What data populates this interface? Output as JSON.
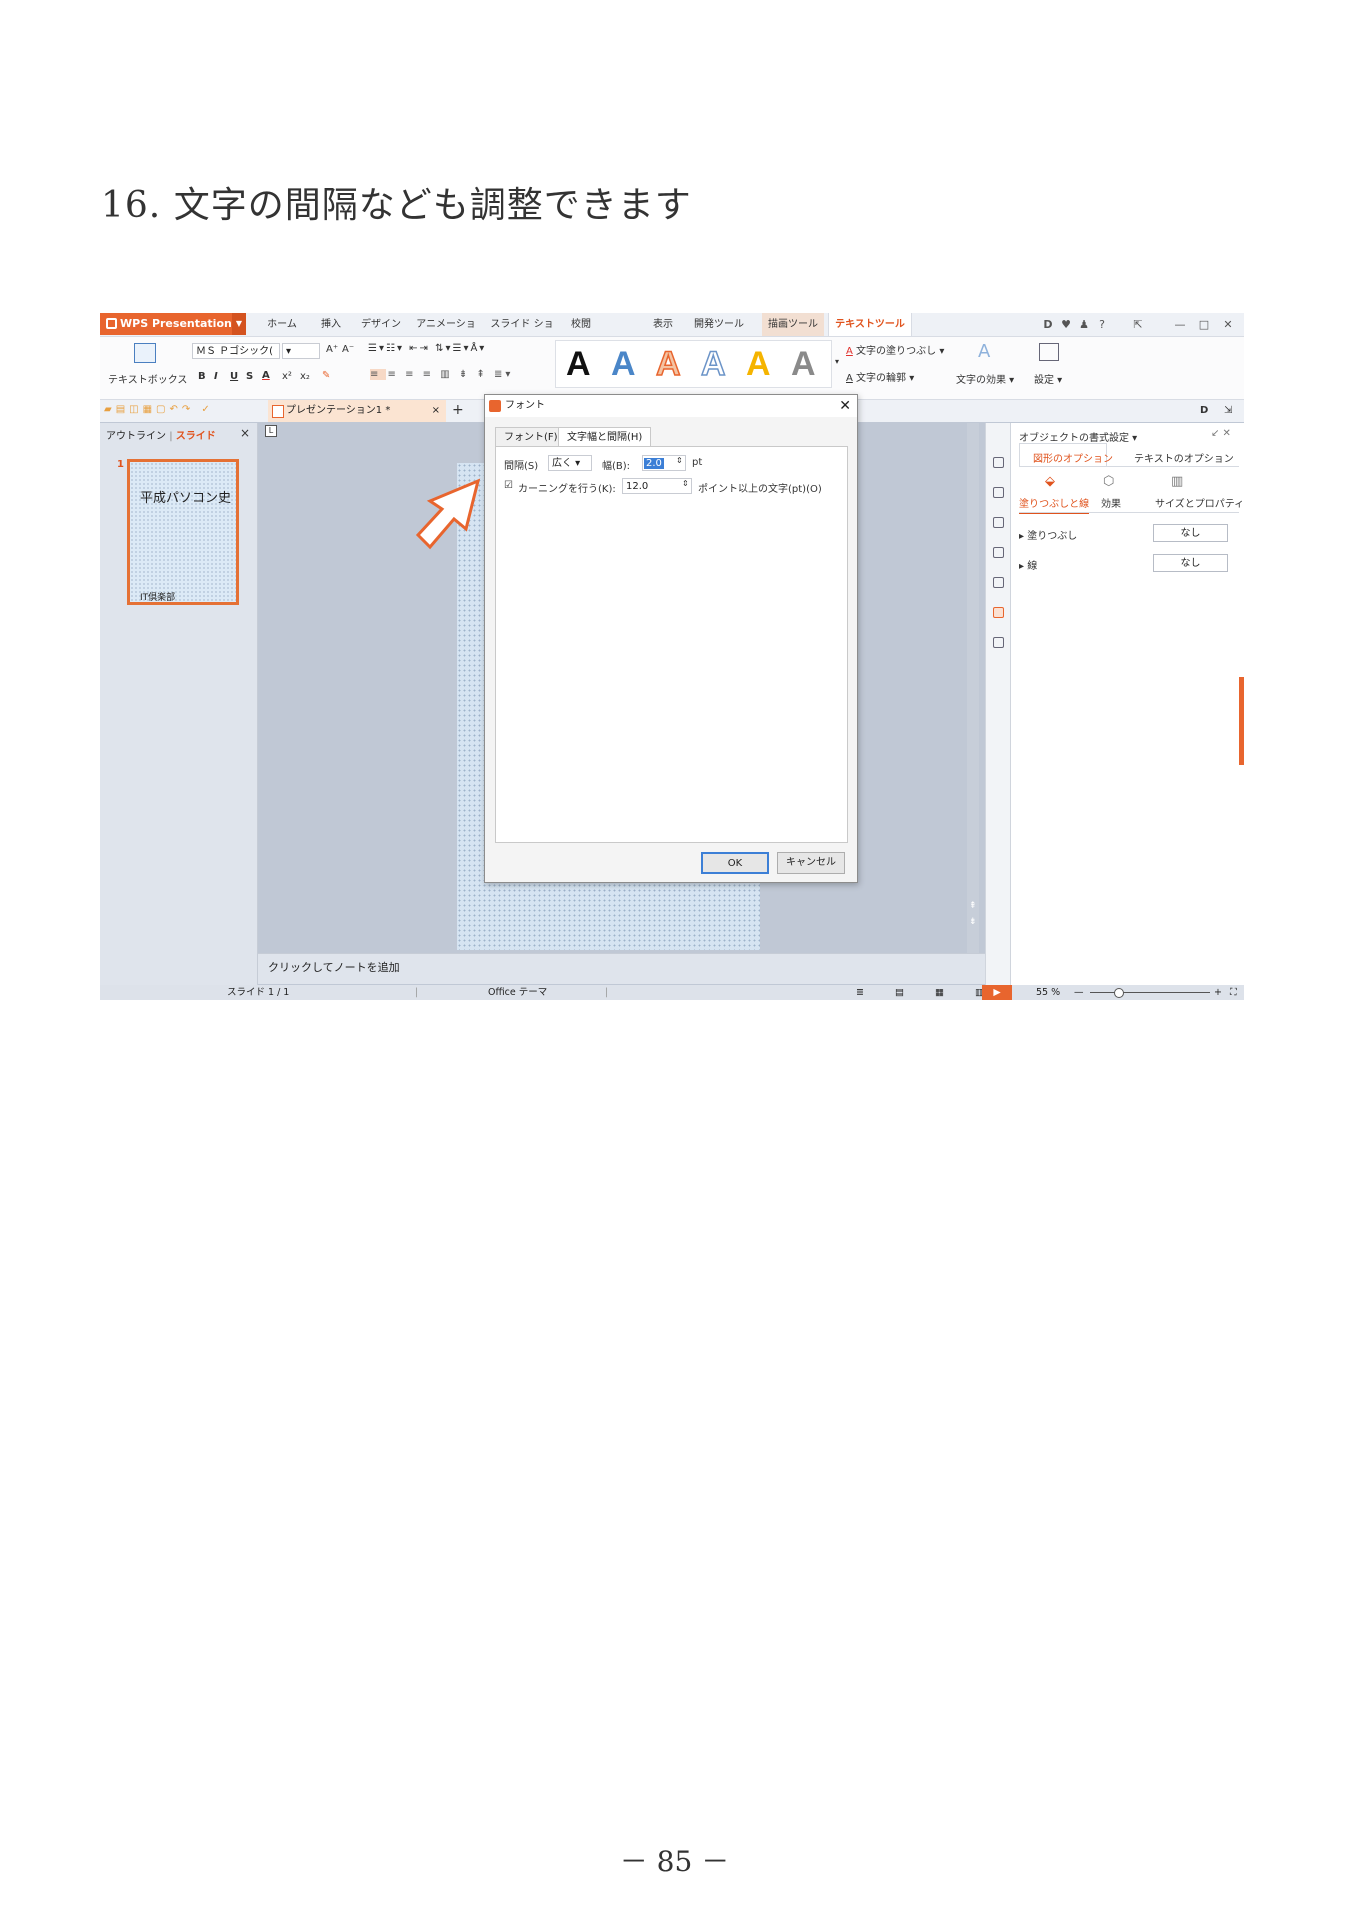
{
  "document": {
    "heading": "16.  文字の間隔なども調整できます",
    "page_number": "－ 85 －"
  },
  "app": {
    "name": "WPS Presentation",
    "menu_tabs": [
      "ホーム",
      "挿入",
      "デザイン",
      "アニメーション",
      "スライド ショー",
      "校閲",
      "表示",
      "開発ツール",
      "描画ツール",
      "テキストツール"
    ],
    "window_controls": [
      "D",
      "?",
      "—",
      "□",
      "✕"
    ]
  },
  "ribbon": {
    "textbox_label": "テキストボックス",
    "font_name": "ＭＳ Ｐゴシック(",
    "font_grow": "A⁺",
    "font_shrink": "A⁻",
    "format_buttons": [
      "B",
      "I",
      "U",
      "S",
      "A",
      "x²",
      "x₂"
    ],
    "style_letters": [
      "A",
      "A",
      "A",
      "A",
      "A",
      "A"
    ],
    "text_fill": "文字の塗りつぶし",
    "text_outline": "文字の輪郭",
    "text_effect": "文字の効果",
    "settings": "設定"
  },
  "tabs": {
    "doc_title": "プレゼンテーション1 *",
    "add": "+"
  },
  "left_pane": {
    "tab_outline": "アウトライン",
    "tab_slide": "スライド",
    "close": "×",
    "slide_number": "1",
    "thumb_title": "平成パソコン史",
    "thumb_subtitle": "IT倶楽部"
  },
  "notes": {
    "placeholder": "クリックしてノートを追加"
  },
  "status": {
    "slide_info": "スライド 1 / 1",
    "theme": "Office テーマ",
    "zoom": "55 %"
  },
  "right_panel": {
    "title": "オブジェクトの書式設定 ▾",
    "tab_shape": "図形のオプション",
    "tab_text": "テキストのオプション",
    "sub_fill_line": "塗りつぶしと線",
    "sub_effect": "効果",
    "sub_size": "サイズとプロパティ",
    "fill_label": "塗りつぶし",
    "fill_value": "なし",
    "line_label": "線",
    "line_value": "なし"
  },
  "dialog": {
    "title": "フォント",
    "close": "✕",
    "tab_font": "フォント(F)",
    "tab_spacing": "文字幅と間隔(H)",
    "spacing_label": "間隔(S)",
    "spacing_value": "広く",
    "width_label": "幅(B):",
    "width_value": "2.0",
    "width_unit": "pt",
    "kerning_label": "カーニングを行う(K):",
    "kerning_value": "12.0",
    "kerning_suffix": "ポイント以上の文字(pt)(O)",
    "ok": "OK",
    "cancel": "キャンセル"
  },
  "colors": {
    "accent": "#e8652e",
    "active_tab_text": "#e0531d",
    "dialog_highlight": "#3c7fd6"
  }
}
